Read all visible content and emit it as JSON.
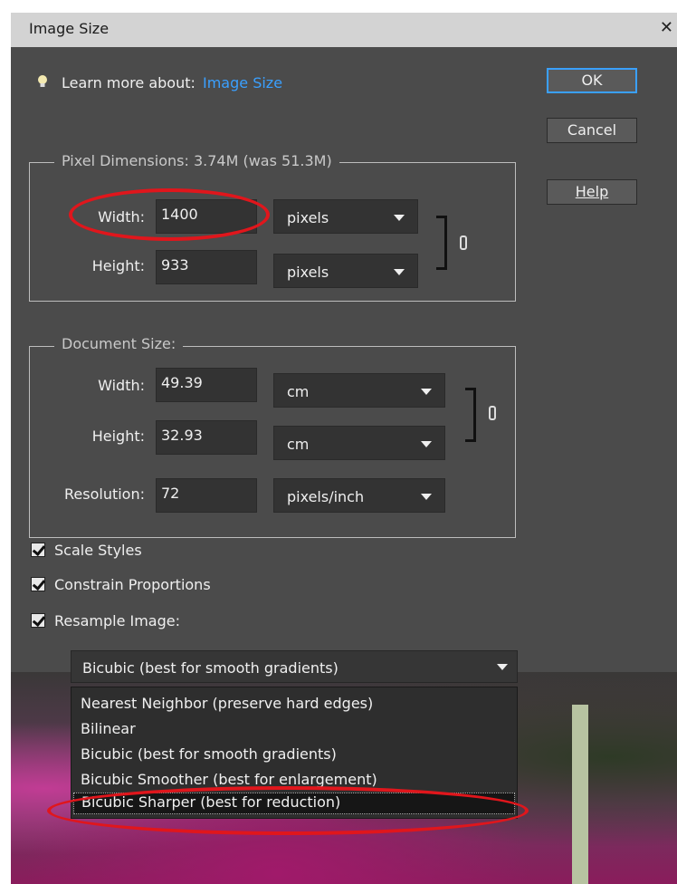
{
  "window": {
    "title": "Image Size",
    "close_glyph": "✕"
  },
  "learn_more": {
    "prefix": "Learn more about:",
    "link": "Image Size"
  },
  "buttons": {
    "ok": "OK",
    "cancel": "Cancel",
    "help": "Help"
  },
  "pixel_dimensions": {
    "legend": "Pixel Dimensions:  3.74M (was 51.3M)",
    "width_label": "Width:",
    "width_value": "1400",
    "width_unit": "pixels",
    "height_label": "Height:",
    "height_value": "933",
    "height_unit": "pixels"
  },
  "document_size": {
    "legend": "Document Size:",
    "width_label": "Width:",
    "width_value": "49.39",
    "width_unit": "cm",
    "height_label": "Height:",
    "height_value": "32.93",
    "height_unit": "cm",
    "resolution_label": "Resolution:",
    "resolution_value": "72",
    "resolution_unit": "pixels/inch"
  },
  "options": {
    "scale_styles": "Scale Styles",
    "constrain_proportions": "Constrain Proportions",
    "resample_image": "Resample Image:"
  },
  "resample": {
    "selected": "Bicubic (best for smooth gradients)",
    "menu": [
      "Nearest Neighbor (preserve hard edges)",
      "Bilinear",
      "Bicubic (best for smooth gradients)",
      "Bicubic Smoother (best for enlargement)",
      "Bicubic Sharper (best for reduction)"
    ]
  },
  "colors": {
    "accent": "#3aa0ff",
    "annotation": "#e0161c",
    "dialog_bg": "#4b4b4b"
  }
}
